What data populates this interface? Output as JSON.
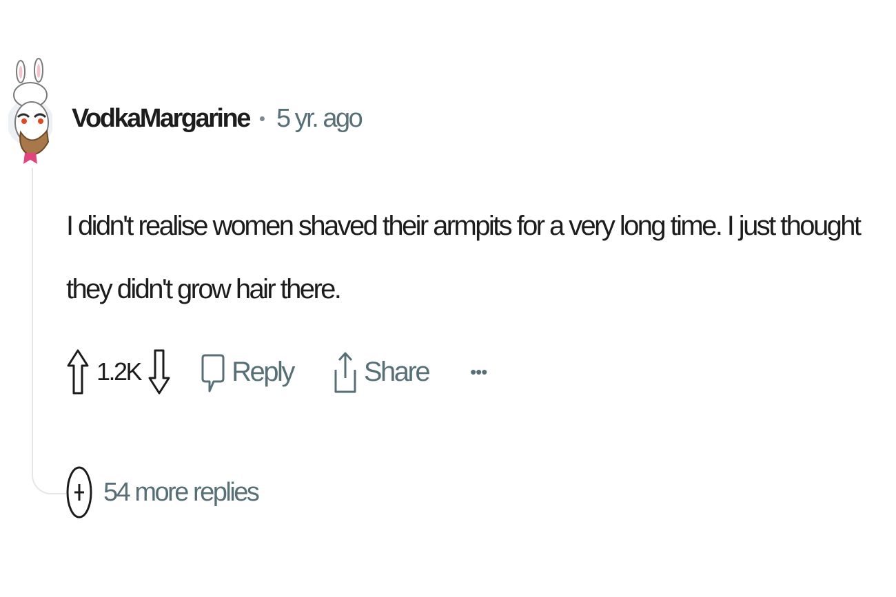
{
  "comment": {
    "author": "VodkaMargarine",
    "separator": "•",
    "timestamp": "5 yr. ago",
    "body": "I didn't realise women shaved their armpits for a very long time. I just thought they didn't grow hair there."
  },
  "actions": {
    "upvote_icon": "upvote-arrow-icon",
    "vote_count": "1.2K",
    "downvote_icon": "downvote-arrow-icon",
    "reply_icon": "speech-bubble-icon",
    "reply_label": "Reply",
    "share_icon": "share-upload-icon",
    "share_label": "Share",
    "more_label": "•••"
  },
  "thread": {
    "expand_icon": "plus-circle-icon",
    "more_replies_label": "54 more replies"
  },
  "colors": {
    "text_primary": "#1c1c1c",
    "text_secondary": "#576f76",
    "thread_line": "#e4e6e8",
    "avatar_accent": "#e0457b"
  }
}
